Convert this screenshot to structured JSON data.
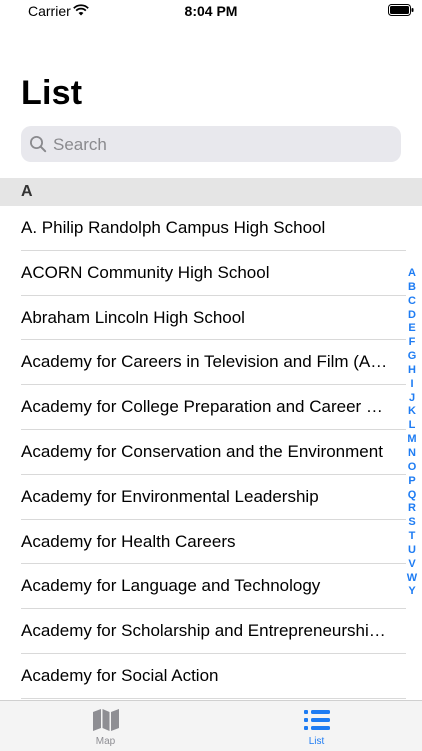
{
  "status_bar": {
    "carrier": "Carrier",
    "time": "8:04 PM"
  },
  "page": {
    "title": "List"
  },
  "search": {
    "placeholder": "Search",
    "value": ""
  },
  "section": {
    "header": "A"
  },
  "schools": [
    "A. Philip Randolph Campus High School",
    "ACORN Community High School",
    "Abraham Lincoln High School",
    "Academy for Careers in Television and Film (A…",
    "Academy for College Preparation and Career E…",
    "Academy for Conservation and the Environment",
    "Academy for Environmental Leadership",
    "Academy for Health Careers",
    "Academy for Language and Technology",
    "Academy for Scholarship and Entrepreneurshi…",
    "Academy for Social Action"
  ],
  "index_letters": [
    "A",
    "B",
    "C",
    "D",
    "E",
    "F",
    "G",
    "H",
    "I",
    "J",
    "K",
    "L",
    "M",
    "N",
    "O",
    "P",
    "Q",
    "R",
    "S",
    "T",
    "U",
    "V",
    "W",
    "Y"
  ],
  "tabs": [
    {
      "label": "Map",
      "icon": "map-icon",
      "selected": false
    },
    {
      "label": "List",
      "icon": "list-icon",
      "selected": true
    }
  ],
  "colors": {
    "accent": "#1e7cf3",
    "inactive": "#8e8e93",
    "section_bg": "#e5e5e5"
  }
}
